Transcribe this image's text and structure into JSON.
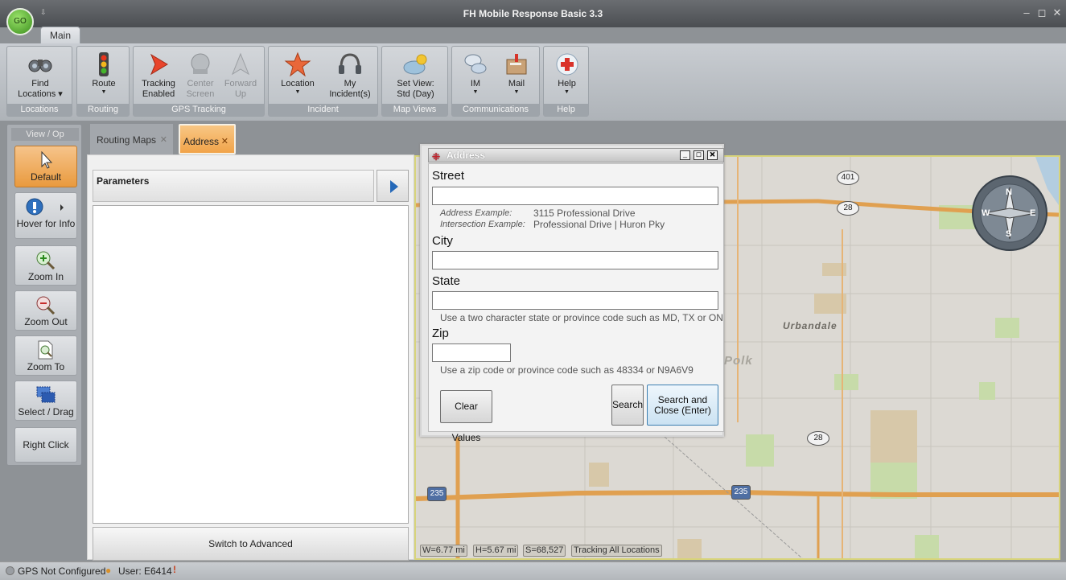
{
  "app": {
    "title": "FH Mobile Response Basic 3.3",
    "go_label": "GO",
    "quick_access": "⇩"
  },
  "window_controls": {
    "minimize": "–",
    "restore": "◻",
    "close": "✕"
  },
  "ribbon": {
    "tab_label": "Main",
    "groups": [
      {
        "label": "Locations",
        "buttons": [
          {
            "label": "Find\nLocations ▾",
            "icon": "binoculars-icon"
          }
        ]
      },
      {
        "label": "Routing",
        "buttons": [
          {
            "label": "Route",
            "icon": "traffic-light-icon"
          }
        ]
      },
      {
        "label": "GPS Tracking",
        "buttons": [
          {
            "label": "Tracking\nEnabled",
            "icon": "tracking-arrow-icon"
          },
          {
            "label": "Center\nScreen",
            "icon": "center-screen-icon"
          },
          {
            "label": "Forward\nUp",
            "icon": "forward-up-icon"
          }
        ]
      },
      {
        "label": "Incident",
        "buttons": [
          {
            "label": "Location",
            "icon": "star-icon"
          },
          {
            "label": "My\nIncident(s)",
            "icon": "headset-icon"
          }
        ]
      },
      {
        "label": "Map Views",
        "buttons": [
          {
            "label": "Set View:\nStd (Day)",
            "icon": "map-view-icon"
          }
        ]
      },
      {
        "label": "Communications",
        "buttons": [
          {
            "label": "IM",
            "icon": "chat-bubbles-icon"
          },
          {
            "label": "Mail",
            "icon": "mailbox-icon"
          }
        ]
      },
      {
        "label": "Help",
        "buttons": [
          {
            "label": "Help",
            "icon": "help-icon"
          }
        ]
      }
    ]
  },
  "left_panel": {
    "header": "View / Op",
    "tools": [
      {
        "label": "Default",
        "icon": "cursor-icon",
        "selected": true
      },
      {
        "label": "Hover for Info",
        "icon": "info-hover-icon"
      },
      {
        "label": "Zoom In",
        "icon": "zoom-in-icon"
      },
      {
        "label": "Zoom Out",
        "icon": "zoom-out-icon"
      },
      {
        "label": "Zoom To",
        "icon": "zoom-to-icon"
      },
      {
        "label": "Select / Drag",
        "icon": "select-drag-icon"
      },
      {
        "label": "Right Click",
        "icon": ""
      }
    ]
  },
  "doc_tabs": [
    {
      "label": "Routing Maps",
      "active": false
    },
    {
      "label": "Address",
      "active": true
    }
  ],
  "parameters_panel": {
    "header": "Parameters",
    "advanced_button": "Switch to Advanced"
  },
  "address_dialog": {
    "title": "Address",
    "street_label": "Street",
    "street_value": "",
    "address_example_label": "Address Example:",
    "address_example": "3115 Professional Drive",
    "intersection_example_label": "Intersection Example:",
    "intersection_example": "Professional Drive | Huron Pky",
    "city_label": "City",
    "city_value": "",
    "state_label": "State",
    "state_value": "",
    "state_hint": "Use a two character state or province code such as MD, TX or ON",
    "zip_label": "Zip",
    "zip_value": "",
    "zip_hint": "Use a zip code or province code such as 48334 or N9A6V9",
    "clear_button": "Clear Values",
    "search_button": "Search",
    "search_close_button": "Search and Close (Enter)"
  },
  "map": {
    "place_labels": [
      "Urbandale",
      "Polk"
    ],
    "route_shields": [
      "401",
      "28",
      "28",
      "235",
      "235"
    ],
    "status": [
      "W=6.77 mi",
      "H=5.67 mi",
      "S=68,527",
      "Tracking All Locations"
    ],
    "compass_letters": [
      "N",
      "E",
      "S",
      "W"
    ]
  },
  "status_bar": {
    "gps": "GPS Not Configured",
    "user": "User: E6414"
  }
}
